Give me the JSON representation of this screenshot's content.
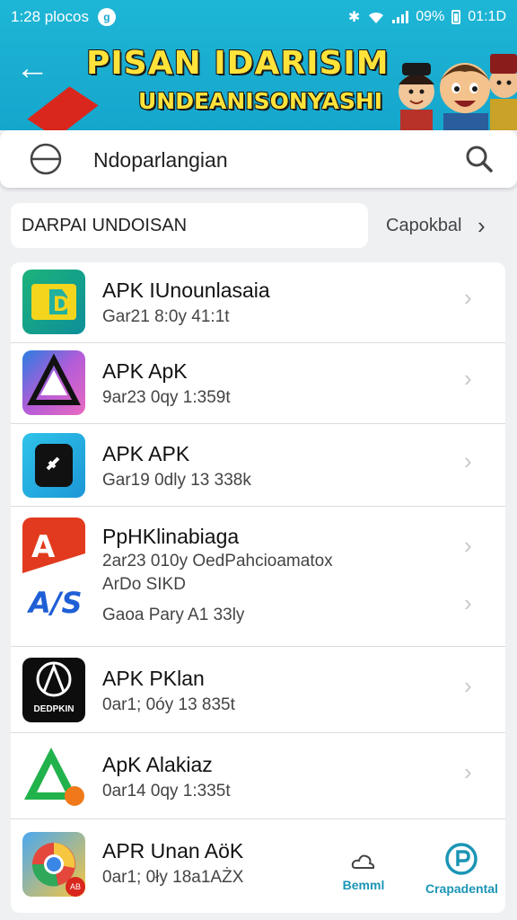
{
  "status": {
    "time": "1:28 plocos",
    "icon": "g",
    "battery_text": "09%",
    "clock_right": "01:1D"
  },
  "header": {
    "banner_line1": "PISAN IDARISIM",
    "banner_line2": "UNDEANISONYASHI"
  },
  "search": {
    "value": "Ndoparlangian"
  },
  "section": {
    "title": "DARPAI UNDOISAN",
    "more_label": "Capokbal"
  },
  "apps": [
    {
      "name": "APK IUnounlasaia",
      "meta": "Gar21 8:0y  41:1t"
    },
    {
      "name": "APK ApK",
      "meta": "9ar23 0qy  1:359t"
    },
    {
      "name": "APK APK",
      "meta": "Gar19 0dly 13 338k"
    },
    {
      "name": "PpHKlinabiaga",
      "meta": "2ar23 010y  OedPahcioamatox",
      "meta2": "ArDo SIKD",
      "meta3": "Gaoa Pary  A1 33ly",
      "icon_text": "A/S"
    },
    {
      "name": "APK PKlan",
      "meta": "0ar1; 0óy 13 835t",
      "icon_text": "DEDPKIN"
    },
    {
      "name": "ApK Alakiaz",
      "meta": "0ar14 0qy 1:335t"
    },
    {
      "name": "APR Unan AöK",
      "meta": "0ar1; 0ły 18a1AŻX",
      "icon_badge": "AB"
    }
  ],
  "nav": {
    "item1": "Bemml",
    "item2": "Crapadental"
  },
  "colors": {
    "header_bg": "#1eb6d6",
    "banner_text": "#ffe33a",
    "accent": "#1b95b5"
  }
}
